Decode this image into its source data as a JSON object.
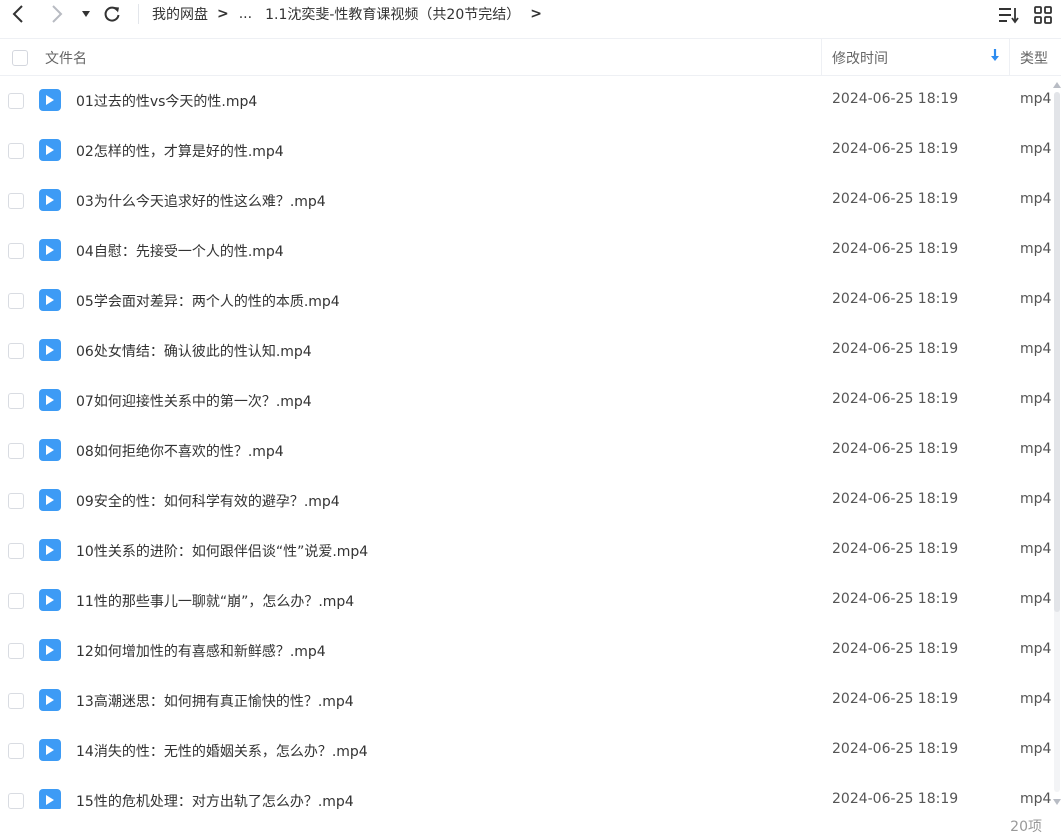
{
  "toolbar": {
    "back_icon": "chevron-left-icon",
    "forward_icon": "chevron-right-icon",
    "history_icon": "caret-down-icon",
    "refresh_icon": "refresh-icon",
    "breadcrumb": [
      "我的网盘",
      "...",
      "1.1沈奕斐-性教育课视频（共20节完结）"
    ],
    "sort_view_icon": "sort-lines-icon",
    "grid_view_icon": "grid-view-icon"
  },
  "header": {
    "name": "文件名",
    "modified": "修改时间",
    "type": "类型",
    "sort_icon": "arrow-down-icon",
    "accent_color": "#2d8cf0"
  },
  "files": [
    {
      "name": "01过去的性vs今天的性.mp4",
      "time": "2024-06-25 18:19",
      "type": "mp4"
    },
    {
      "name": "02怎样的性，才算是好的性.mp4",
      "time": "2024-06-25 18:19",
      "type": "mp4"
    },
    {
      "name": "03为什么今天追求好的性这么难？.mp4",
      "time": "2024-06-25 18:19",
      "type": "mp4"
    },
    {
      "name": "04自慰：先接受一个人的性.mp4",
      "time": "2024-06-25 18:19",
      "type": "mp4"
    },
    {
      "name": "05学会面对差异：两个人的性的本质.mp4",
      "time": "2024-06-25 18:19",
      "type": "mp4"
    },
    {
      "name": "06处女情结：确认彼此的性认知.mp4",
      "time": "2024-06-25 18:19",
      "type": "mp4"
    },
    {
      "name": "07如何迎接性关系中的第一次？.mp4",
      "time": "2024-06-25 18:19",
      "type": "mp4"
    },
    {
      "name": "08如何拒绝你不喜欢的性？.mp4",
      "time": "2024-06-25 18:19",
      "type": "mp4"
    },
    {
      "name": "09安全的性：如何科学有效的避孕？.mp4",
      "time": "2024-06-25 18:19",
      "type": "mp4"
    },
    {
      "name": "10性关系的进阶：如何跟伴侣谈“性”说爱.mp4",
      "time": "2024-06-25 18:19",
      "type": "mp4"
    },
    {
      "name": "11性的那些事儿一聊就“崩”，怎么办？.mp4",
      "time": "2024-06-25 18:19",
      "type": "mp4"
    },
    {
      "name": "12如何增加性的有喜感和新鲜感？.mp4",
      "time": "2024-06-25 18:19",
      "type": "mp4"
    },
    {
      "name": "13高潮迷思：如何拥有真正愉快的性？.mp4",
      "time": "2024-06-25 18:19",
      "type": "mp4"
    },
    {
      "name": "14消失的性：无性的婚姻关系，怎么办？.mp4",
      "time": "2024-06-25 18:19",
      "type": "mp4"
    },
    {
      "name": "15性的危机处理：对方出轨了怎么办？.mp4",
      "time": "2024-06-25 18:19",
      "type": "mp4"
    }
  ],
  "file_icon": "video-file-icon",
  "file_icon_color": "#3d9bf5",
  "footer": {
    "count": "20项"
  }
}
